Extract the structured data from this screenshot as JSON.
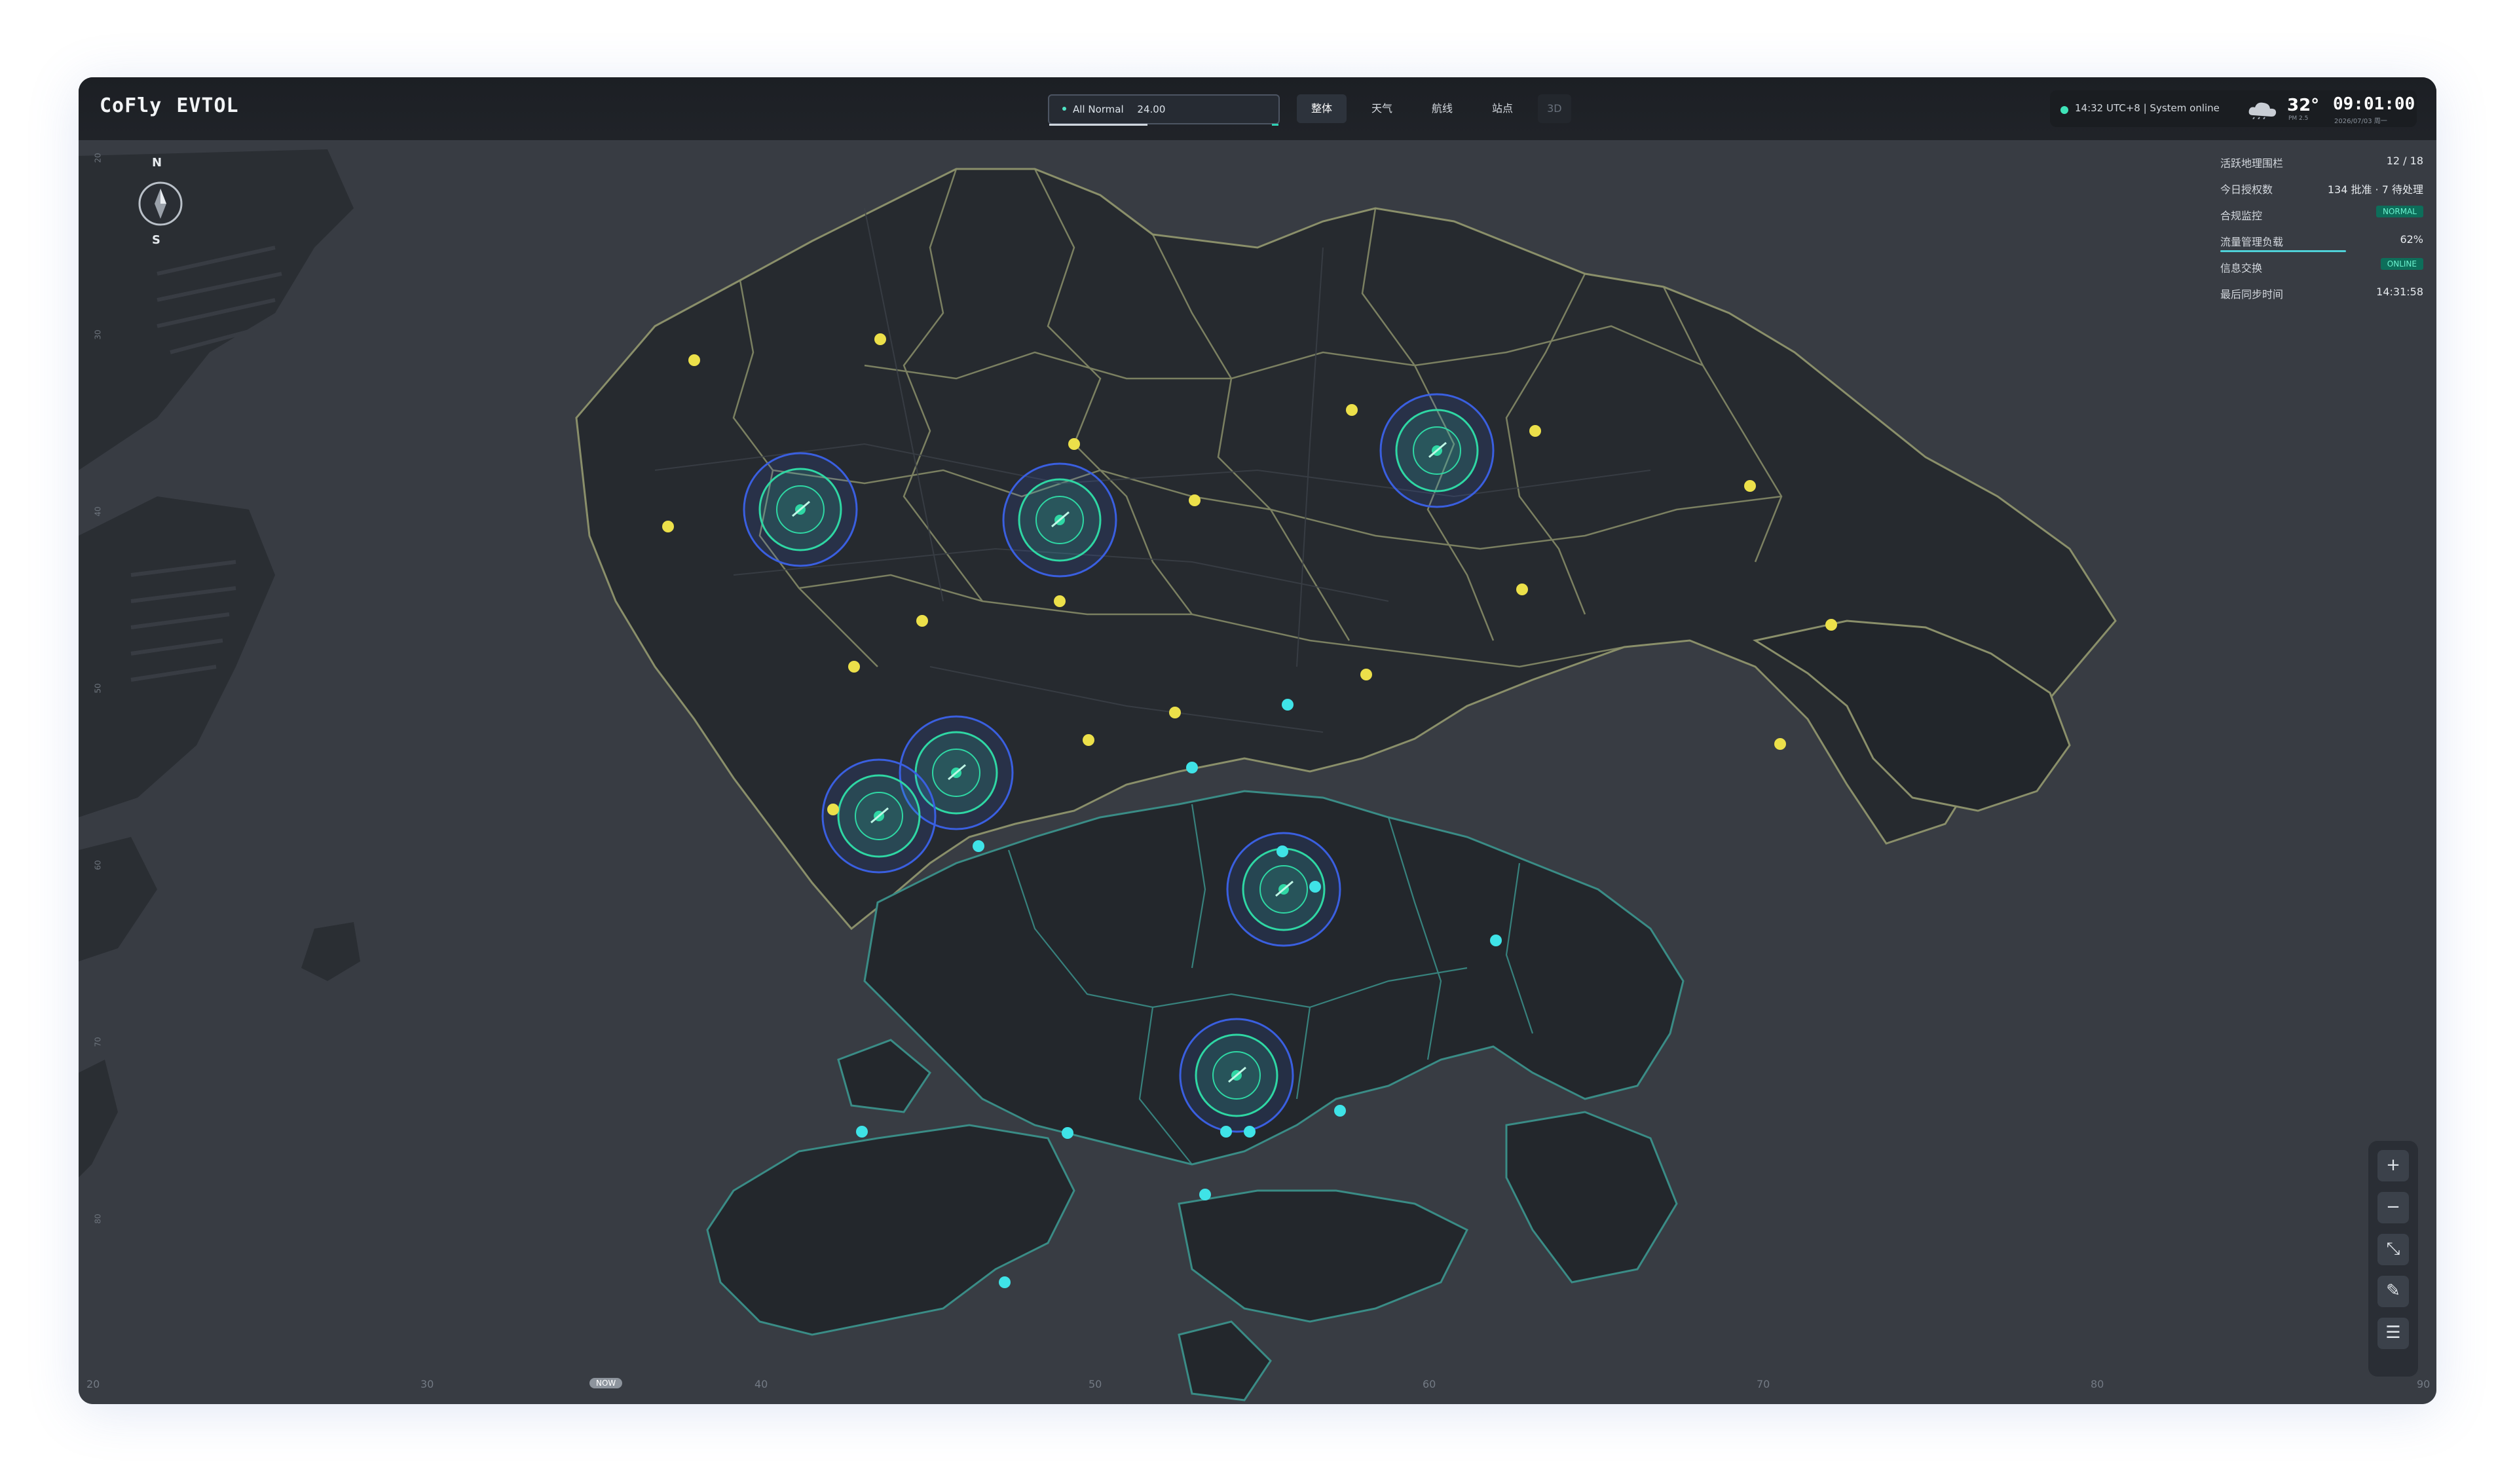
{
  "app": {
    "brand_left": "CoFly",
    "brand_right": "EVTOL"
  },
  "status": {
    "text": "All Normal",
    "count": "24.00",
    "dot_color": "#4fe3c4"
  },
  "tabs": [
    {
      "label": "整体",
      "active": true
    },
    {
      "label": "天气",
      "active": false
    },
    {
      "label": "航线",
      "active": false
    },
    {
      "label": "站点",
      "active": false
    },
    {
      "label": "3D",
      "active": false
    }
  ],
  "system": {
    "status_text": "14:32 UTC+8 | System online",
    "temperature": "32°",
    "temperature_sub": "PM 2.5",
    "clock": "09:01:00",
    "date": "2026/07/03 周一",
    "weather_icon": "cloud-icon"
  },
  "compass": {
    "north": "N",
    "south": "S"
  },
  "stats": [
    {
      "label": "活跃地理围栏",
      "value": "12 / 18"
    },
    {
      "label": "今日授权数",
      "value": "134 批准 · 7 待处理"
    },
    {
      "label": "合规监控",
      "badge": "NORMAL"
    },
    {
      "label": "流量管理负载",
      "value": "62%",
      "meter": 0.62
    },
    {
      "label": "信息交换",
      "badge": "ONLINE"
    },
    {
      "label": "最后同步时间",
      "value": "14:31:58"
    }
  ],
  "ruler_bottom": {
    "ticks": [
      "20",
      "30",
      "40",
      "50",
      "60",
      "70",
      "80",
      "90"
    ],
    "now_label": "NOW"
  },
  "ruler_left": {
    "ticks": [
      "20",
      "30",
      "40",
      "50",
      "60",
      "70",
      "80"
    ]
  },
  "zoom_controls": [
    {
      "name": "zoom-in-button",
      "glyph": "+"
    },
    {
      "name": "zoom-out-button",
      "glyph": "−"
    },
    {
      "name": "fullscreen-button",
      "glyph": "⤡"
    },
    {
      "name": "draw-button",
      "glyph": "✎"
    },
    {
      "name": "layers-button",
      "glyph": "☰"
    }
  ],
  "colors": {
    "water": "#383c43",
    "land": "#2a2e33",
    "border": "#8a8f6a",
    "teal_border": "#3a8c86",
    "hub_green": "#2fd7a4",
    "hub_blue": "#3a6cff",
    "poi_yellow": "#ece04a",
    "poi_cyan": "#3fe3e7"
  }
}
